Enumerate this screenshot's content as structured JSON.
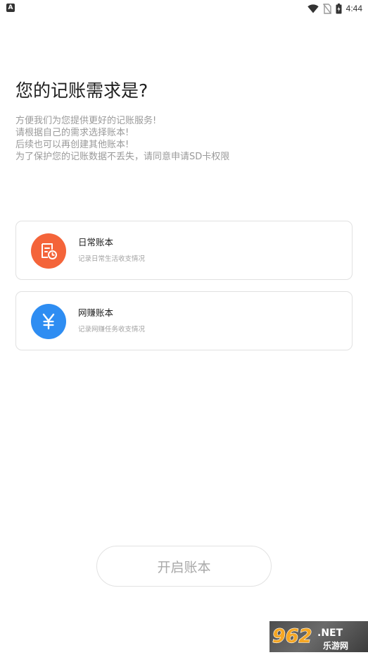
{
  "status_bar": {
    "time": "4:44",
    "app_icon_letter": "A",
    "icons": [
      "wifi-icon",
      "no-sim-icon",
      "battery-icon"
    ]
  },
  "header": {
    "title": "您的记账需求是?",
    "description_lines": [
      "方便我们为您提供更好的记账服务!",
      "请根据自己的需求选择账本!",
      "后续也可以再创建其他账本!",
      "为了保护您的记账数据不丢失，请同意申请SD卡权限"
    ]
  },
  "books": [
    {
      "title": "日常账本",
      "subtitle": "记录日常生活收支情况",
      "icon": "daily-ledger-icon",
      "color": "#F4643A"
    },
    {
      "title": "网赚账本",
      "subtitle": "记录网赚任务收支情况",
      "icon": "yuan-icon",
      "color": "#2E8DF2"
    }
  ],
  "actions": {
    "open_label": "开启账本"
  },
  "watermark": {
    "brand": "962",
    "suffix": ".NET",
    "site_name": "乐游网"
  }
}
